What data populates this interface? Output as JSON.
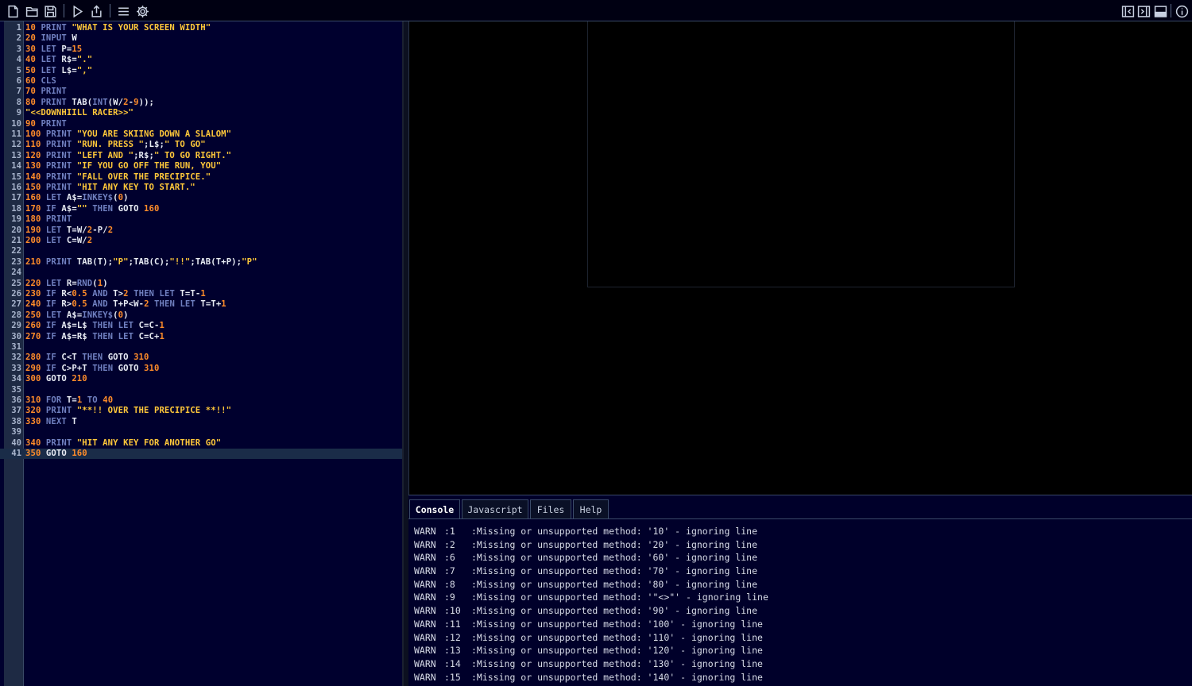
{
  "toolbar": {
    "left_icons": [
      "new-file-icon",
      "open-folder-icon",
      "save-icon",
      "run-icon",
      "export-icon",
      "menu-icon",
      "settings-icon"
    ],
    "right_icons": [
      "collapse-left-icon",
      "collapse-right-icon",
      "toggle-panel-icon",
      "info-icon"
    ]
  },
  "editor": {
    "active_line": 41,
    "lines": [
      [
        [
          "n",
          "10 "
        ],
        [
          "k",
          "PRINT "
        ],
        [
          "s",
          "\"WHAT IS YOUR SCREEN WIDTH\""
        ]
      ],
      [
        [
          "n",
          "20 "
        ],
        [
          "k",
          "INPUT "
        ],
        [
          "i",
          "W"
        ]
      ],
      [
        [
          "n",
          "30 "
        ],
        [
          "k",
          "LET "
        ],
        [
          "i",
          "P"
        ],
        [
          "o",
          "="
        ],
        [
          "n",
          "15"
        ]
      ],
      [
        [
          "n",
          "40 "
        ],
        [
          "k",
          "LET "
        ],
        [
          "i",
          "R$"
        ],
        [
          "o",
          "="
        ],
        [
          "s",
          "\".\""
        ]
      ],
      [
        [
          "n",
          "50 "
        ],
        [
          "k",
          "LET "
        ],
        [
          "i",
          "L$"
        ],
        [
          "o",
          "="
        ],
        [
          "s",
          "\",\""
        ]
      ],
      [
        [
          "n",
          "60 "
        ],
        [
          "k",
          "CLS"
        ]
      ],
      [
        [
          "n",
          "70 "
        ],
        [
          "k",
          "PRINT"
        ]
      ],
      [
        [
          "n",
          "80 "
        ],
        [
          "k",
          "PRINT "
        ],
        [
          "i",
          "TAB("
        ],
        [
          "k",
          "INT"
        ],
        [
          "i",
          "(W"
        ],
        [
          "o",
          "/"
        ],
        [
          "n",
          "2"
        ],
        [
          "o",
          "-"
        ],
        [
          "n",
          "9"
        ],
        [
          "i",
          ")"
        ],
        [
          "i",
          ");"
        ]
      ],
      [
        [
          "s",
          "\"<<DOWNHIILL RACER>>\""
        ]
      ],
      [
        [
          "n",
          "90 "
        ],
        [
          "k",
          "PRINT"
        ]
      ],
      [
        [
          "n",
          "100 "
        ],
        [
          "k",
          "PRINT "
        ],
        [
          "s",
          "\"YOU ARE SKIING DOWN A SLALOM\""
        ]
      ],
      [
        [
          "n",
          "110 "
        ],
        [
          "k",
          "PRINT "
        ],
        [
          "s",
          "\"RUN. PRESS \""
        ],
        [
          "i",
          ";L$;"
        ],
        [
          "s",
          "\" TO GO\""
        ]
      ],
      [
        [
          "n",
          "120 "
        ],
        [
          "k",
          "PRINT "
        ],
        [
          "s",
          "\"LEFT AND \""
        ],
        [
          "i",
          ";R$;"
        ],
        [
          "s",
          "\" TO GO RIGHT.\""
        ]
      ],
      [
        [
          "n",
          "130 "
        ],
        [
          "k",
          "PRINT "
        ],
        [
          "s",
          "\"IF YOU GO OFF THE RUN, YOU\""
        ]
      ],
      [
        [
          "n",
          "140 "
        ],
        [
          "k",
          "PRINT "
        ],
        [
          "s",
          "\"FALL OVER THE PRECIPICE.\""
        ]
      ],
      [
        [
          "n",
          "150 "
        ],
        [
          "k",
          "PRINT "
        ],
        [
          "s",
          "\"HIT ANY KEY TO START.\""
        ]
      ],
      [
        [
          "n",
          "160 "
        ],
        [
          "k",
          "LET "
        ],
        [
          "i",
          "A$"
        ],
        [
          "o",
          "="
        ],
        [
          "k",
          "INKEY$"
        ],
        [
          "i",
          "("
        ],
        [
          "n",
          "0"
        ],
        [
          "i",
          ")"
        ]
      ],
      [
        [
          "n",
          "170 "
        ],
        [
          "k",
          "IF "
        ],
        [
          "i",
          "A$"
        ],
        [
          "o",
          "="
        ],
        [
          "s",
          "\"\" "
        ],
        [
          "k",
          "THEN "
        ],
        [
          "i",
          "GOTO "
        ],
        [
          "n",
          "160"
        ]
      ],
      [
        [
          "n",
          "180 "
        ],
        [
          "k",
          "PRINT"
        ]
      ],
      [
        [
          "n",
          "190 "
        ],
        [
          "k",
          "LET "
        ],
        [
          "i",
          "T"
        ],
        [
          "o",
          "="
        ],
        [
          "i",
          "W"
        ],
        [
          "o",
          "/"
        ],
        [
          "n",
          "2"
        ],
        [
          "o",
          "-"
        ],
        [
          "i",
          "P"
        ],
        [
          "o",
          "/"
        ],
        [
          "n",
          "2"
        ]
      ],
      [
        [
          "n",
          "200 "
        ],
        [
          "k",
          "LET "
        ],
        [
          "i",
          "C"
        ],
        [
          "o",
          "="
        ],
        [
          "i",
          "W"
        ],
        [
          "o",
          "/"
        ],
        [
          "n",
          "2"
        ]
      ],
      [],
      [
        [
          "n",
          "210 "
        ],
        [
          "k",
          "PRINT "
        ],
        [
          "i",
          "TAB(T);"
        ],
        [
          "s",
          "\"P\""
        ],
        [
          "i",
          ";TAB(C);"
        ],
        [
          "s",
          "\"!!\""
        ],
        [
          "i",
          ";TAB(T+P);"
        ],
        [
          "s",
          "\"P\""
        ]
      ],
      [],
      [
        [
          "n",
          "220 "
        ],
        [
          "k",
          "LET "
        ],
        [
          "i",
          "R"
        ],
        [
          "o",
          "="
        ],
        [
          "k",
          "RND"
        ],
        [
          "i",
          "("
        ],
        [
          "n",
          "1"
        ],
        [
          "i",
          ")"
        ]
      ],
      [
        [
          "n",
          "230 "
        ],
        [
          "k",
          "IF "
        ],
        [
          "i",
          "R"
        ],
        [
          "o",
          "<"
        ],
        [
          "n",
          "0.5 "
        ],
        [
          "k",
          "AND "
        ],
        [
          "i",
          "T"
        ],
        [
          "o",
          ">"
        ],
        [
          "n",
          "2 "
        ],
        [
          "k",
          "THEN "
        ],
        [
          "k",
          "LET "
        ],
        [
          "i",
          "T"
        ],
        [
          "o",
          "="
        ],
        [
          "i",
          "T"
        ],
        [
          "o",
          "-"
        ],
        [
          "n",
          "1"
        ]
      ],
      [
        [
          "n",
          "240 "
        ],
        [
          "k",
          "IF "
        ],
        [
          "i",
          "R"
        ],
        [
          "o",
          ">"
        ],
        [
          "n",
          "0.5 "
        ],
        [
          "k",
          "AND "
        ],
        [
          "i",
          "T"
        ],
        [
          "o",
          "+"
        ],
        [
          "i",
          "P"
        ],
        [
          "o",
          "<"
        ],
        [
          "i",
          "W"
        ],
        [
          "o",
          "-"
        ],
        [
          "n",
          "2 "
        ],
        [
          "k",
          "THEN "
        ],
        [
          "k",
          "LET "
        ],
        [
          "i",
          "T"
        ],
        [
          "o",
          "="
        ],
        [
          "i",
          "T"
        ],
        [
          "o",
          "+"
        ],
        [
          "n",
          "1"
        ]
      ],
      [
        [
          "n",
          "250 "
        ],
        [
          "k",
          "LET "
        ],
        [
          "i",
          "A$"
        ],
        [
          "o",
          "="
        ],
        [
          "k",
          "INKEY$"
        ],
        [
          "i",
          "("
        ],
        [
          "n",
          "0"
        ],
        [
          "i",
          ")"
        ]
      ],
      [
        [
          "n",
          "260 "
        ],
        [
          "k",
          "IF "
        ],
        [
          "i",
          "A$"
        ],
        [
          "o",
          "="
        ],
        [
          "i",
          "L$ "
        ],
        [
          "k",
          "THEN "
        ],
        [
          "k",
          "LET "
        ],
        [
          "i",
          "C"
        ],
        [
          "o",
          "="
        ],
        [
          "i",
          "C"
        ],
        [
          "o",
          "-"
        ],
        [
          "n",
          "1"
        ]
      ],
      [
        [
          "n",
          "270 "
        ],
        [
          "k",
          "IF "
        ],
        [
          "i",
          "A$"
        ],
        [
          "o",
          "="
        ],
        [
          "i",
          "R$ "
        ],
        [
          "k",
          "THEN "
        ],
        [
          "k",
          "LET "
        ],
        [
          "i",
          "C"
        ],
        [
          "o",
          "="
        ],
        [
          "i",
          "C"
        ],
        [
          "o",
          "+"
        ],
        [
          "n",
          "1"
        ]
      ],
      [],
      [
        [
          "n",
          "280 "
        ],
        [
          "k",
          "IF "
        ],
        [
          "i",
          "C"
        ],
        [
          "o",
          "<"
        ],
        [
          "i",
          "T "
        ],
        [
          "k",
          "THEN "
        ],
        [
          "i",
          "GOTO "
        ],
        [
          "n",
          "310"
        ]
      ],
      [
        [
          "n",
          "290 "
        ],
        [
          "k",
          "IF "
        ],
        [
          "i",
          "C"
        ],
        [
          "o",
          ">"
        ],
        [
          "i",
          "P"
        ],
        [
          "o",
          "+"
        ],
        [
          "i",
          "T "
        ],
        [
          "k",
          "THEN "
        ],
        [
          "i",
          "GOTO "
        ],
        [
          "n",
          "310"
        ]
      ],
      [
        [
          "n",
          "300 "
        ],
        [
          "i",
          "GOTO "
        ],
        [
          "n",
          "210"
        ]
      ],
      [],
      [
        [
          "n",
          "310 "
        ],
        [
          "k",
          "FOR "
        ],
        [
          "i",
          "T"
        ],
        [
          "o",
          "="
        ],
        [
          "n",
          "1 "
        ],
        [
          "k",
          "TO "
        ],
        [
          "n",
          "40"
        ]
      ],
      [
        [
          "n",
          "320 "
        ],
        [
          "k",
          "PRINT "
        ],
        [
          "s",
          "\"**!! OVER THE PRECIPICE **!!\""
        ]
      ],
      [
        [
          "n",
          "330 "
        ],
        [
          "k",
          "NEXT "
        ],
        [
          "i",
          "T"
        ]
      ],
      [],
      [
        [
          "n",
          "340 "
        ],
        [
          "k",
          "PRINT "
        ],
        [
          "s",
          "\"HIT ANY KEY FOR ANOTHER GO\""
        ]
      ],
      [
        [
          "n",
          "350 "
        ],
        [
          "i",
          "GOTO "
        ],
        [
          "n",
          "160"
        ]
      ]
    ]
  },
  "tabs": [
    {
      "label": "Console",
      "active": true
    },
    {
      "label": "Javascript",
      "active": false
    },
    {
      "label": "Files",
      "active": false
    },
    {
      "label": "Help",
      "active": false
    }
  ],
  "console": [
    {
      "level": "WARN",
      "line": "1",
      "msg": "Missing or unsupported method: '10' - ignoring line"
    },
    {
      "level": "WARN",
      "line": "2",
      "msg": "Missing or unsupported method: '20' - ignoring line"
    },
    {
      "level": "WARN",
      "line": "6",
      "msg": "Missing or unsupported method: '60' - ignoring line"
    },
    {
      "level": "WARN",
      "line": "7",
      "msg": "Missing or unsupported method: '70' - ignoring line"
    },
    {
      "level": "WARN",
      "line": "8",
      "msg": "Missing or unsupported method: '80' - ignoring line"
    },
    {
      "level": "WARN",
      "line": "9",
      "msg": "Missing or unsupported method: '\"<>\"' - ignoring line"
    },
    {
      "level": "WARN",
      "line": "10",
      "msg": "Missing or unsupported method: '90' - ignoring line"
    },
    {
      "level": "WARN",
      "line": "11",
      "msg": "Missing or unsupported method: '100' - ignoring line"
    },
    {
      "level": "WARN",
      "line": "12",
      "msg": "Missing or unsupported method: '110' - ignoring line"
    },
    {
      "level": "WARN",
      "line": "13",
      "msg": "Missing or unsupported method: '120' - ignoring line"
    },
    {
      "level": "WARN",
      "line": "14",
      "msg": "Missing or unsupported method: '130' - ignoring line"
    },
    {
      "level": "WARN",
      "line": "15",
      "msg": "Missing or unsupported method: '140' - ignoring line"
    }
  ]
}
